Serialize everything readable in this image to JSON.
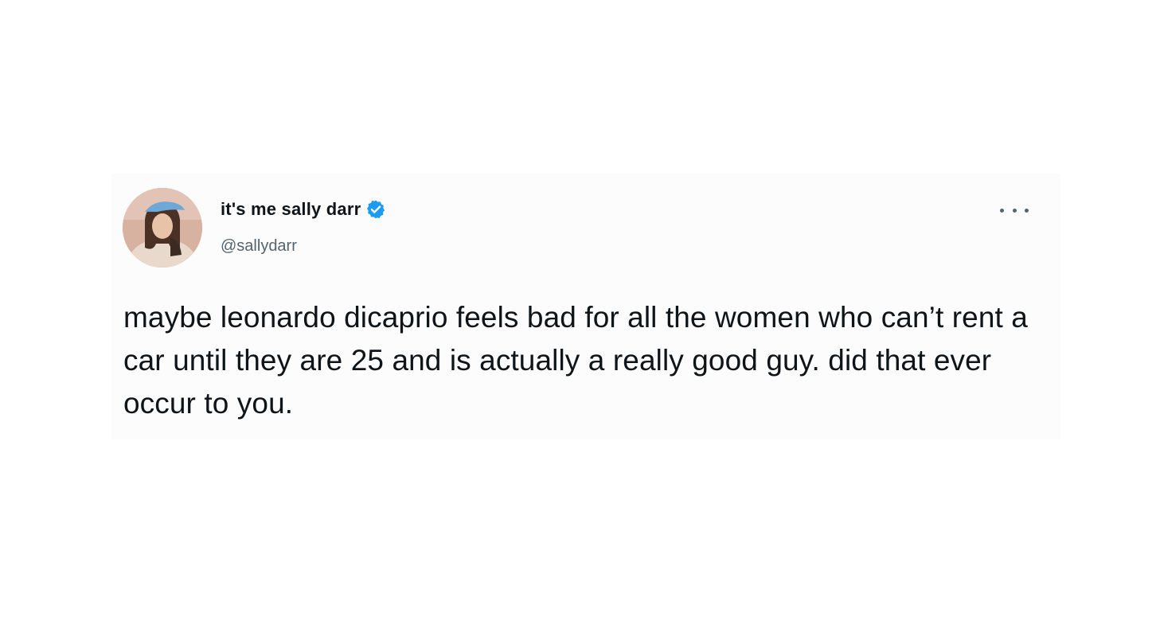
{
  "tweet": {
    "display_name": "it's me sally darr",
    "handle": "@sallydarr",
    "verified": true,
    "text": "maybe leonardo dicaprio feels bad for all the women who can’t rent a car until they are 25 and is actually a really good guy. did that ever occur to you.",
    "icons": {
      "avatar": "profile-photo",
      "verified": "verified-badge-icon",
      "more": "more-options-icon"
    }
  },
  "colors": {
    "text": "#0f1419",
    "secondary_text": "#536471",
    "verified_blue": "#1d9bf0",
    "card_background": "#fcfcfc"
  }
}
